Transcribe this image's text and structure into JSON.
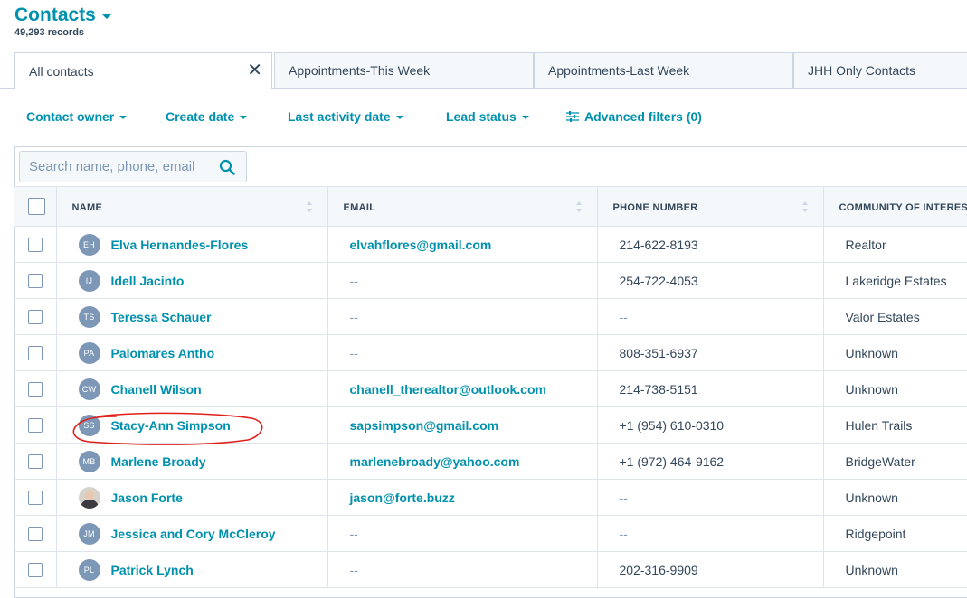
{
  "header": {
    "title": "Contacts",
    "records": "49,293 records"
  },
  "tabs": [
    {
      "label": "All contacts",
      "active": true
    },
    {
      "label": "Appointments-This Week"
    },
    {
      "label": "Appointments-Last Week"
    },
    {
      "label": "JHH Only Contacts"
    }
  ],
  "filters": {
    "contact_owner": "Contact owner",
    "create_date": "Create date",
    "last_activity_date": "Last activity date",
    "lead_status": "Lead status",
    "advanced": "Advanced filters (0)"
  },
  "search": {
    "placeholder": "Search name, phone, email"
  },
  "columns": {
    "name": "NAME",
    "email": "EMAIL",
    "phone": "PHONE NUMBER",
    "community": "COMMUNITY OF INTEREST"
  },
  "rows": [
    {
      "initials": "EH",
      "name": "Elva Hernandes-Flores",
      "email": "elvahflores@gmail.com",
      "phone": "214-622-8193",
      "community": "Realtor"
    },
    {
      "initials": "IJ",
      "name": "Idell Jacinto",
      "email": "--",
      "phone": "254-722-4053",
      "community": "Lakeridge Estates"
    },
    {
      "initials": "TS",
      "name": "Teressa Schauer",
      "email": "--",
      "phone": "--",
      "community": "Valor Estates"
    },
    {
      "initials": "PA",
      "name": "Palomares Antho",
      "email": "--",
      "phone": "808-351-6937",
      "community": "Unknown"
    },
    {
      "initials": "CW",
      "name": "Chanell Wilson",
      "email": "chanell_therealtor@outlook.com",
      "phone": "214-738-5151",
      "community": "Unknown"
    },
    {
      "initials": "SS",
      "name": "Stacy-Ann Simpson",
      "email": "sapsimpson@gmail.com",
      "phone": "+1 (954) 610-0310",
      "community": "Hulen Trails"
    },
    {
      "initials": "MB",
      "name": "Marlene Broady",
      "email": "marlenebroady@yahoo.com",
      "phone": "+1 (972) 464-9162",
      "community": "BridgeWater"
    },
    {
      "initials": "",
      "name": "Jason Forte",
      "email": "jason@forte.buzz",
      "phone": "--",
      "community": "Unknown"
    },
    {
      "initials": "JM",
      "name": "Jessica and Cory McCleroy",
      "email": "--",
      "phone": "--",
      "community": "Ridgepoint"
    },
    {
      "initials": "PL",
      "name": "Patrick Lynch",
      "email": "--",
      "phone": "202-316-9909",
      "community": "Unknown"
    }
  ],
  "colors": {
    "accent": "#0091ae",
    "text": "#33475b",
    "avatar": "#7c98b6",
    "annotation": "#e0201b"
  }
}
